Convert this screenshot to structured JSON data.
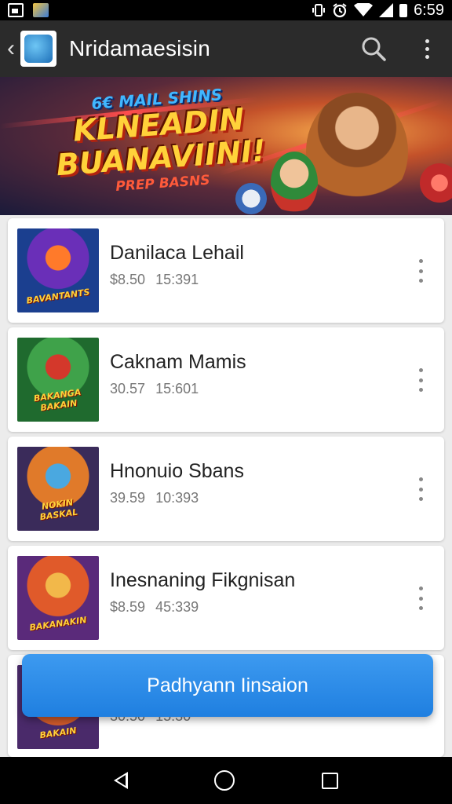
{
  "status_bar": {
    "time": "6:59",
    "icons": [
      "image-notification-icon",
      "app-notification-icon",
      "vibrate-icon",
      "alarm-icon",
      "wifi-icon",
      "signal-icon",
      "battery-icon"
    ]
  },
  "app_bar": {
    "title": "Nridamaesisin",
    "back_icon": "chevron-left-icon",
    "search_icon": "search-icon",
    "more_icon": "more-vertical-icon"
  },
  "banner": {
    "top_line": "6€ MAIL SHINS",
    "headline_1": "KLNEADIN",
    "headline_2": "BUANAVIINI!",
    "sub_line": "PREP BASNS"
  },
  "items": [
    {
      "title": "Danilaca Lehail",
      "price": "$8.50",
      "time": "15:391",
      "thumb_label": "BAVANTANTS",
      "thumb_colors": [
        "#1b3f8f",
        "#6a2fb8",
        "#ff7a2a"
      ]
    },
    {
      "title": "Caknam Mamis",
      "price": "30.57",
      "time": "15:601",
      "thumb_label": "BAKANGA BAKAIN",
      "thumb_colors": [
        "#1f6a2e",
        "#3fa24a",
        "#d4382b"
      ]
    },
    {
      "title": "Hnonuio Sbans",
      "price": "39.59",
      "time": "10:393",
      "thumb_label": "NOKIN BASKAL",
      "thumb_colors": [
        "#3a2b5a",
        "#e07a2a",
        "#4aa8e0"
      ]
    },
    {
      "title": "Inesnaning Fikgnisan",
      "price": "$8.59",
      "time": "45:339",
      "thumb_label": "BAKANAKIN",
      "thumb_colors": [
        "#5a2a7a",
        "#e05a2a",
        "#f2b84a"
      ]
    },
    {
      "title": "",
      "price": "30.50",
      "time": "15:30",
      "thumb_label": "BAKAIN",
      "thumb_colors": [
        "#4a2a6a",
        "#d05a2a",
        "#f0a030"
      ]
    }
  ],
  "primary_action": {
    "label": "Padhyann Iinsaion"
  },
  "nav_bar": {
    "icons": [
      "back-triangle-icon",
      "home-circle-icon",
      "recents-square-icon"
    ]
  },
  "colors": {
    "app_bar": "#2b2b2b",
    "accent": "#1f7fe0",
    "background": "#ececec"
  }
}
